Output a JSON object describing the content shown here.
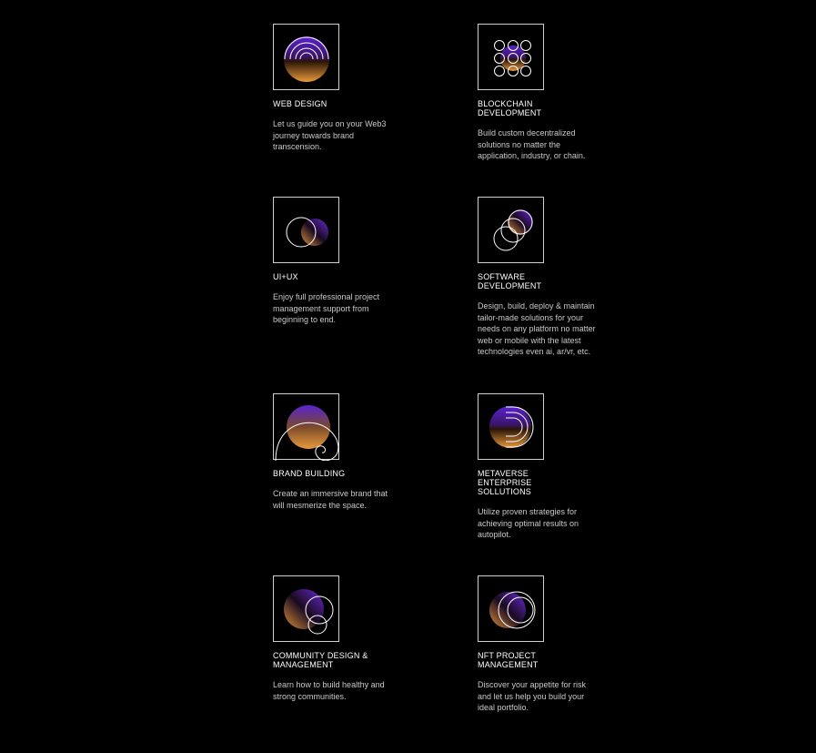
{
  "colors": {
    "background": "#000000",
    "accent_purple": "#6a2bd9",
    "accent_orange": "#e0923a",
    "line": "#ffffff"
  },
  "services": [
    {
      "title": "WEB DESIGN",
      "description": "Let us guide you on your Web3\njourney towards brand\ntranscension.",
      "icon": "arcs-icon"
    },
    {
      "title": "BLOCKCHAIN\nDEVELOPMENT",
      "description": "Build custom decentralized\nsolutions no matter the\napplication, industry, or chain.",
      "icon": "circle-grid-icon"
    },
    {
      "title": "UI+UX",
      "description": "Enjoy full professional project\nmanagement support from\nbeginning to end.",
      "icon": "overlapping-circles-icon"
    },
    {
      "title": "SOFTWARE\nDEVELOPMENT",
      "description": "Design, build, deploy & maintain\ntailor-made solutions for your\nneeds on any platform no matter\nweb or mobile with the latest\ntechnologies even ai, ar/vr, etc.",
      "icon": "chain-circles-icon"
    },
    {
      "title": "BRAND BUILDING",
      "description": "Create an immersive brand that\nwill mesmerize the space.",
      "icon": "spiral-icon"
    },
    {
      "title": "METAVERSE\nENTERPRISE\nSOLLUTIONS",
      "description": "Utilize proven strategies for\nachieving optimal results on\nautopilot.",
      "icon": "nested-d-icon"
    },
    {
      "title": "COMMUNITY DESIGN &\nMANAGEMENT",
      "description": "Learn how to build healthy and\nstrong communities.",
      "icon": "community-circles-icon"
    },
    {
      "title": "NFT PROJECT\nMANAGEMENT",
      "description": "Discover your appetite for risk\nand let us help you build your\nideal portfolio.",
      "icon": "orbit-circles-icon"
    }
  ]
}
